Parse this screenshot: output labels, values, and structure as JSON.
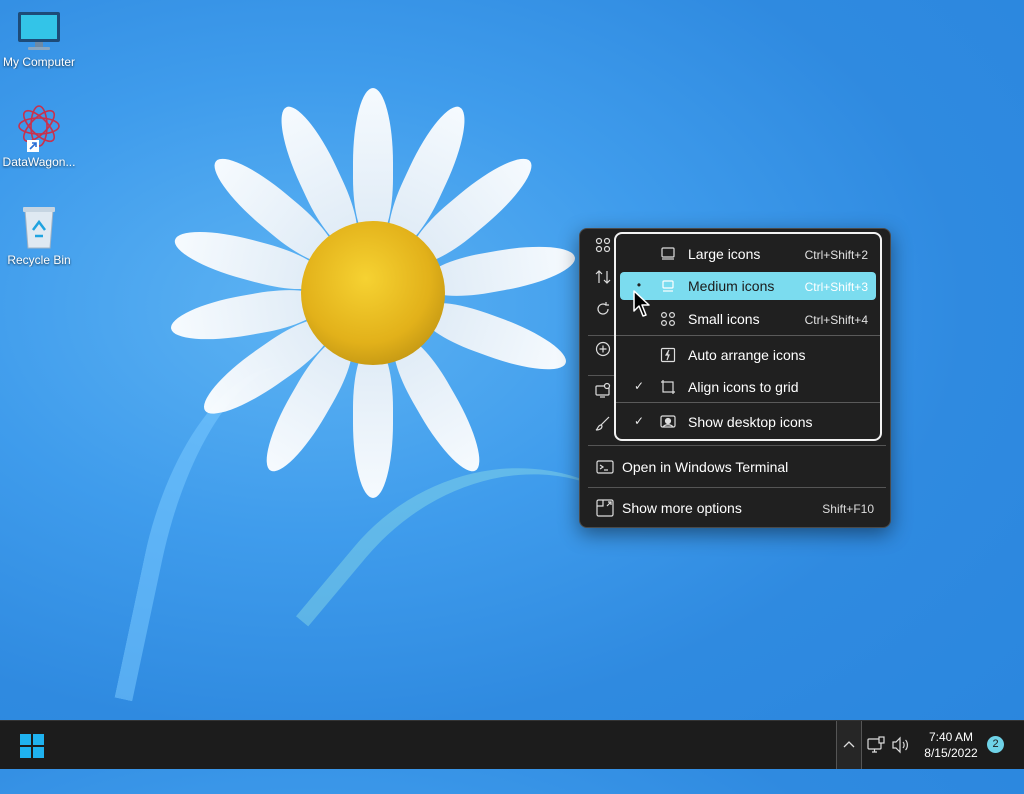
{
  "desktop": {
    "icons": [
      {
        "label": "My Computer",
        "icon": "monitor-icon"
      },
      {
        "label": "DataWagon...",
        "icon": "app-shortcut-icon"
      },
      {
        "label": "Recycle Bin",
        "icon": "recycle-bin-icon"
      }
    ]
  },
  "context_menu": {
    "side_icons": [
      "view-icon",
      "sort-icon",
      "refresh-icon",
      "new-icon",
      "display-settings-icon",
      "personalize-icon"
    ],
    "items": [
      {
        "label": "Open in Windows Terminal",
        "icon": "terminal-icon",
        "shortcut": ""
      },
      {
        "label": "Show more options",
        "icon": "more-options-icon",
        "shortcut": "Shift+F10"
      }
    ]
  },
  "view_submenu": {
    "items": [
      {
        "label": "Large icons",
        "shortcut": "Ctrl+Shift+2",
        "icon": "large-icons-icon",
        "mark": "",
        "selected": false
      },
      {
        "label": "Medium icons",
        "shortcut": "Ctrl+Shift+3",
        "icon": "medium-icons-icon",
        "mark": "•",
        "selected": true
      },
      {
        "label": "Small icons",
        "shortcut": "Ctrl+Shift+4",
        "icon": "small-icons-icon",
        "mark": "",
        "selected": false
      },
      {
        "label": "Auto arrange icons",
        "shortcut": "",
        "icon": "auto-arrange-icon",
        "mark": "",
        "selected": false
      },
      {
        "label": "Align icons to grid",
        "shortcut": "",
        "icon": "align-grid-icon",
        "mark": "✓",
        "selected": false
      },
      {
        "label": "Show desktop icons",
        "shortcut": "",
        "icon": "show-desktop-icon",
        "mark": "✓",
        "selected": false
      }
    ]
  },
  "taskbar": {
    "start_icon": "windows-start-icon",
    "tray_icons": [
      "chevron-up-icon",
      "network-icon",
      "volume-icon"
    ],
    "time": "7:40 AM",
    "date": "8/15/2022",
    "notification_count": "2"
  },
  "colors": {
    "wallpaper": "#3f9cec",
    "menu_bg": "#202020",
    "selected_highlight": "#7bdcef",
    "taskbar": "#1c1c1c"
  }
}
